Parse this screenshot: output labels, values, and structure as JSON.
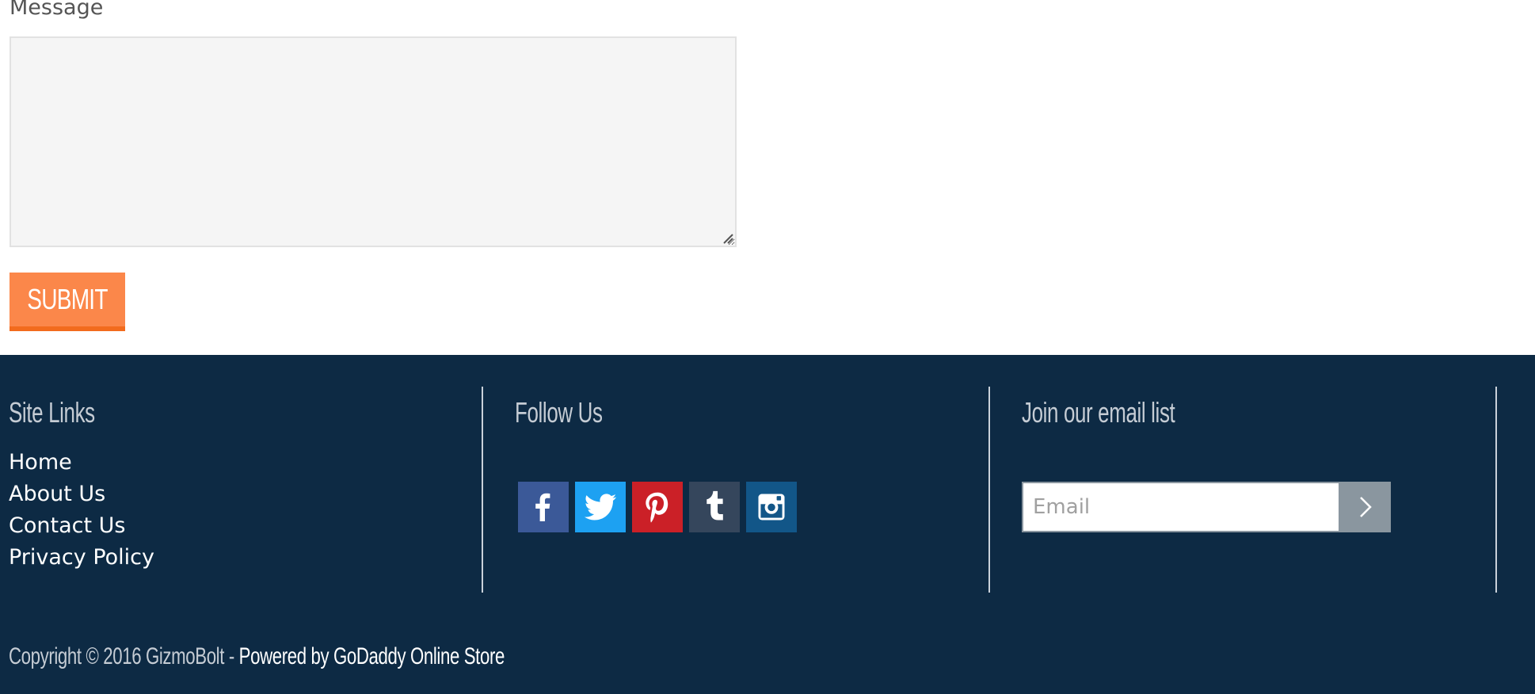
{
  "contact_form": {
    "message_label": "Message",
    "message_value": "",
    "submit_label": "SUBMIT"
  },
  "footer": {
    "site_links": {
      "title": "Site Links",
      "items": [
        {
          "label": "Home"
        },
        {
          "label": "About Us"
        },
        {
          "label": "Contact Us"
        },
        {
          "label": "Privacy Policy"
        }
      ]
    },
    "follow_us": {
      "title": "Follow Us",
      "networks": [
        {
          "name": "Facebook",
          "icon": "facebook-icon",
          "color": "#3b5998"
        },
        {
          "name": "Twitter",
          "icon": "twitter-icon",
          "color": "#1da1f2"
        },
        {
          "name": "Pinterest",
          "icon": "pinterest-icon",
          "color": "#cb2027"
        },
        {
          "name": "Tumblr",
          "icon": "tumblr-icon",
          "color": "#35465c"
        },
        {
          "name": "Instagram",
          "icon": "instagram-icon",
          "color": "#125688"
        }
      ]
    },
    "email_list": {
      "title": "Join our email list",
      "email_placeholder": "Email",
      "email_value": "",
      "submit_icon": "chevron-right-icon"
    },
    "copyright": {
      "text": "Copyright © 2016 GizmoBolt",
      "separator": " - ",
      "powered_by": "Powered by GoDaddy Online Store"
    }
  },
  "colors": {
    "accent_orange": "#fb874a",
    "accent_orange_dark": "#f26b1d",
    "footer_bg": "#0d2a44",
    "footer_heading": "#c5ccd4"
  }
}
